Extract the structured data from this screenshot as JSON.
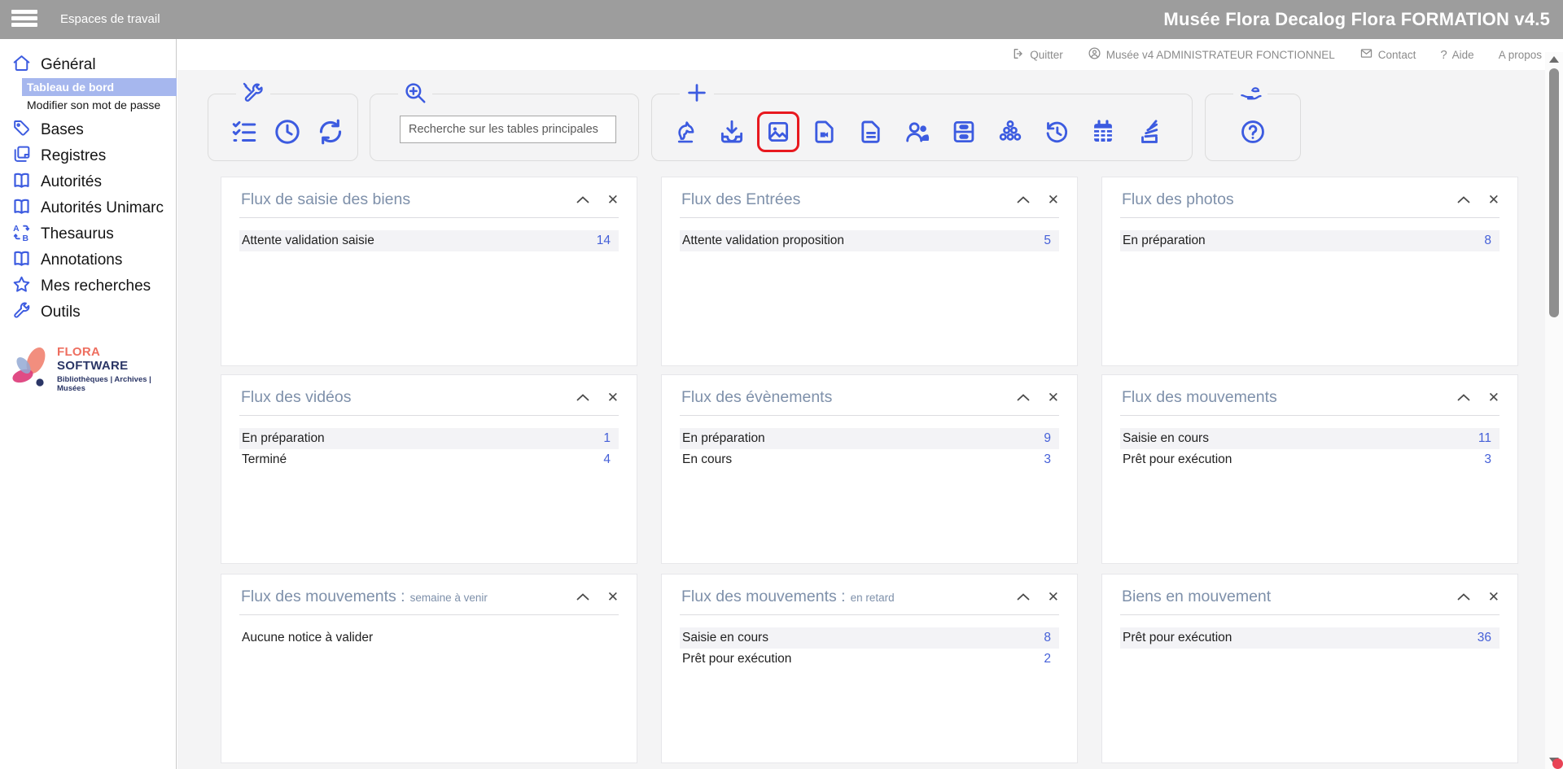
{
  "header": {
    "workspace_label": "Espaces de travail",
    "app_title": "Musée Flora Decalog Flora FORMATION v4.5"
  },
  "account_bar": {
    "quit": "Quitter",
    "user": "Musée v4 ADMINISTRATEUR FONCTIONNEL",
    "contact": "Contact",
    "help_glyph": "?",
    "help": "Aide",
    "about": "A propos"
  },
  "sidebar": {
    "items": [
      {
        "label": "Général",
        "icon": "home-icon"
      },
      {
        "label": "Tableau de bord",
        "selected": true
      },
      {
        "label": "Modifier son mot de passe"
      },
      {
        "label": "Bases",
        "icon": "tag-icon"
      },
      {
        "label": "Registres",
        "icon": "registers-icon"
      },
      {
        "label": "Autorités",
        "icon": "open-book-icon"
      },
      {
        "label": "Autorités Unimarc",
        "icon": "open-book-icon"
      },
      {
        "label": "Thesaurus",
        "icon": "thesaurus-icon"
      },
      {
        "label": "Annotations",
        "icon": "open-book-icon"
      },
      {
        "label": "Mes recherches",
        "icon": "star-icon"
      },
      {
        "label": "Outils",
        "icon": "wrench-icon"
      }
    ],
    "logo": {
      "brand_first": "FLORA",
      "brand_second": "SOFTWARE",
      "tagline": "Bibliothèques | Archives | Musées"
    }
  },
  "toolbar": {
    "search_placeholder": "Recherche sur les tables principales",
    "search_value": "",
    "groups": [
      {
        "legend_icon": "tools-icon",
        "icons": [
          "checklist-icon",
          "clock-icon",
          "refresh-icon"
        ]
      },
      {
        "legend_icon": "zoom-in-icon",
        "icons": [
          "search-input"
        ]
      },
      {
        "legend_icon": "plus-icon",
        "icons": [
          "chess-knight-icon",
          "import-icon",
          "image-icon",
          "video-document-icon",
          "document-icon",
          "users-icon",
          "drawers-icon",
          "network-icon",
          "history-icon",
          "calendar-icon",
          "stack-icon"
        ],
        "highlighted_icon": "image-icon"
      },
      {
        "legend_icon": "assistance-icon",
        "icons": [
          "help-icon"
        ]
      }
    ]
  },
  "widgets": [
    {
      "title": "Flux de saisie des biens",
      "subtitle": "",
      "rows": [
        {
          "label": "Attente validation saisie",
          "value": "14"
        }
      ]
    },
    {
      "title": "Flux des Entrées",
      "subtitle": "",
      "rows": [
        {
          "label": "Attente validation proposition",
          "value": "5"
        }
      ]
    },
    {
      "title": "Flux des photos",
      "subtitle": "",
      "rows": [
        {
          "label": "En préparation",
          "value": "8"
        }
      ]
    },
    {
      "title": "Flux des vidéos",
      "subtitle": "",
      "rows": [
        {
          "label": "En préparation",
          "value": "1"
        },
        {
          "label": "Terminé",
          "value": "4"
        }
      ]
    },
    {
      "title": "Flux des évènements",
      "subtitle": "",
      "rows": [
        {
          "label": "En préparation",
          "value": "9"
        },
        {
          "label": "En cours",
          "value": "3"
        }
      ]
    },
    {
      "title": "Flux des mouvements",
      "subtitle": "",
      "rows": [
        {
          "label": "Saisie en cours",
          "value": "11"
        },
        {
          "label": "Prêt pour exécution",
          "value": "3"
        }
      ]
    },
    {
      "title": "Flux des mouvements :",
      "subtitle": "semaine à venir",
      "rows": [
        {
          "label": "Aucune notice à valider",
          "value": ""
        }
      ]
    },
    {
      "title": "Flux des mouvements :",
      "subtitle": "en retard",
      "rows": [
        {
          "label": "Saisie en cours",
          "value": "8"
        },
        {
          "label": "Prêt pour exécution",
          "value": "2"
        }
      ]
    },
    {
      "title": "Biens en mouvement",
      "subtitle": "",
      "rows": [
        {
          "label": "Prêt pour exécution",
          "value": "36"
        }
      ]
    }
  ],
  "colors": {
    "accent_blue": "#3c5be0",
    "widget_title": "#7e90aa",
    "value_blue": "#4560d8",
    "header_gray": "#9d9d9d",
    "selected_item_bg": "#a6b7ee",
    "highlight_red": "#e8191f",
    "logo_coral": "#ee6e5f",
    "logo_navy": "#2b3666"
  }
}
